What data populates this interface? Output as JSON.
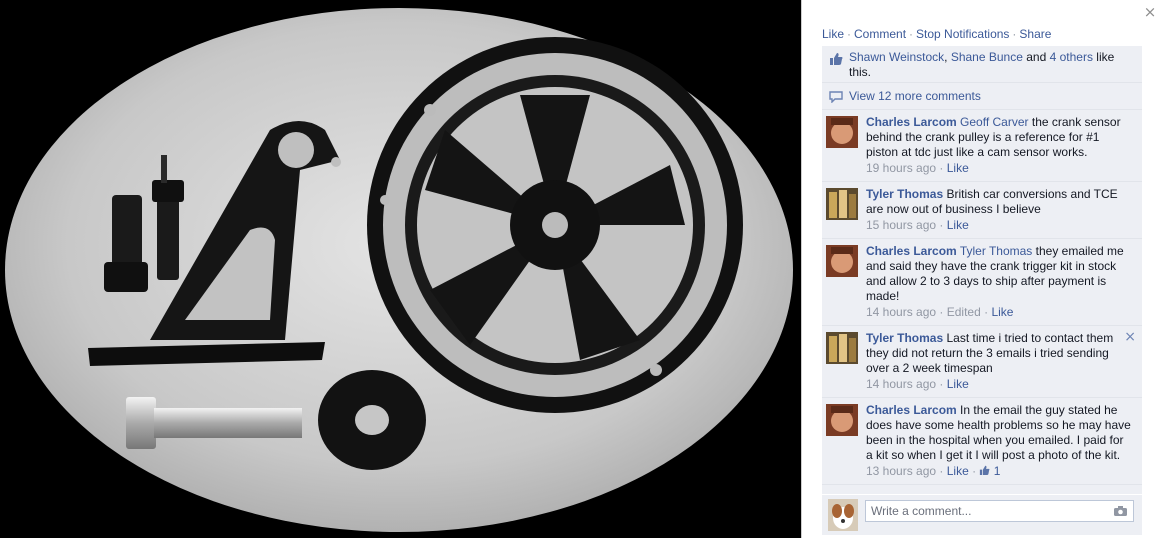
{
  "photo": {
    "subject": "crank trigger kit parts"
  },
  "panel": {
    "close_glyph": "×",
    "actions": [
      "Like",
      "Comment",
      "Stop Notifications",
      "Share"
    ],
    "likes": {
      "name1": "Shawn Weinstock",
      "sep": ", ",
      "name2": "Shane Bunce",
      "and": " and ",
      "others": "4 others",
      "suffix": " like this."
    },
    "view_more": "View 12 more comments",
    "comments": [
      {
        "author": "Charles Larcom",
        "tag": "Geoff Carver",
        "text": " the crank sensor behind the crank pulley is a reference for #1 piston at tdc just like a cam sensor works.",
        "time": "19 hours ago",
        "edited": "",
        "like": "Like",
        "like_count": ""
      },
      {
        "author": "Tyler Thomas",
        "tag": "",
        "text": " British car conversions and TCE are now out of business I believe",
        "time": "15 hours ago",
        "edited": "",
        "like": "Like",
        "like_count": ""
      },
      {
        "author": "Charles Larcom",
        "tag": "Tyler Thomas",
        "text": " they emailed me and said they have the crank trigger kit in stock and allow 2 to 3 days to ship after payment is made!",
        "time": "14 hours ago",
        "edited": "Edited",
        "like": "Like",
        "like_count": ""
      },
      {
        "author": "Tyler Thomas",
        "tag": "",
        "text": " Last time i tried to contact them they did not return the 3 emails i tried sending over a 2 week timespan",
        "time": "14 hours ago",
        "edited": "",
        "like": "Like",
        "like_count": ""
      },
      {
        "author": "Charles Larcom",
        "tag": "",
        "text": " In the email the guy stated he does have some health problems so he may have been in the hospital when you emailed. I paid for a kit so when I get it I will post a photo of the kit.",
        "time": "13 hours ago",
        "edited": "",
        "like": "Like",
        "like_count": "1"
      }
    ],
    "remove_glyph": "×",
    "composer": {
      "placeholder": "Write a comment..."
    },
    "colors": {
      "link": "#3b5998",
      "panel_bg": "#edeff4",
      "meta": "#9197a3"
    }
  }
}
